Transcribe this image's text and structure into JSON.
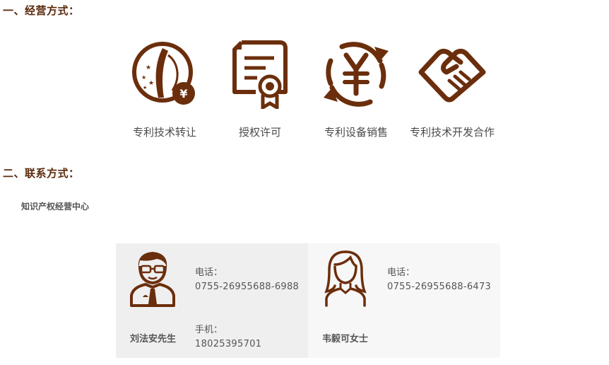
{
  "section1": {
    "title": "一、经营方式："
  },
  "modes": [
    {
      "label": "专利技术转让",
      "icon": "patent-transfer-icon"
    },
    {
      "label": "授权许可",
      "icon": "certificate-icon"
    },
    {
      "label": "专利设备销售",
      "icon": "yen-exchange-icon"
    },
    {
      "label": "专利技术开发合作",
      "icon": "handshake-icon"
    }
  ],
  "section2": {
    "title": "二、联系方式："
  },
  "center_name": "知识产权经营中心",
  "contacts": [
    {
      "name": "刘法安先生",
      "avatar": "man-avatar-icon",
      "phone_label": "电话：",
      "phone": "0755-26955688-6988",
      "mobile_label": "手机：",
      "mobile": "18025395701"
    },
    {
      "name": "韦毅可女士",
      "avatar": "woman-avatar-icon",
      "phone_label": "电话：",
      "phone": "0755-26955688-6473"
    }
  ],
  "colors": {
    "accent": "#6b2e0c",
    "heading": "#5a2a0c",
    "card_bg": "#f5f5f5"
  }
}
